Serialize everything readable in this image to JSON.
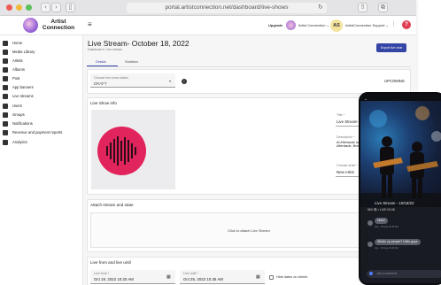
{
  "browser": {
    "url": "portal.artistconnection.net/dashboard/live-shows"
  },
  "brand": {
    "line1": "Artist",
    "line2": "Connection"
  },
  "topbar": {
    "upgrade": "Upgrade",
    "connection_menu": "Artist Connection ⌄",
    "avatar_initials": "AS",
    "support_menu": "ArtistConnection Support ⌄",
    "help": "?"
  },
  "sidebar": {
    "items": [
      {
        "label": "Home",
        "icon": "home-icon"
      },
      {
        "label": "Media Library",
        "icon": "folder-icon"
      },
      {
        "label": "Artists",
        "icon": "artist-icon"
      },
      {
        "label": "Albums",
        "icon": "album-icon"
      },
      {
        "label": "Post",
        "icon": "post-icon"
      },
      {
        "label": "App banners",
        "icon": "banner-icon"
      },
      {
        "label": "Live streams",
        "icon": "monitor-icon"
      },
      {
        "label": "Users",
        "icon": "user-icon"
      },
      {
        "label": "Groups",
        "icon": "group-icon"
      },
      {
        "label": "Notifications",
        "icon": "bell-icon"
      },
      {
        "label": "Revenue and payment reports",
        "icon": "money-icon"
      },
      {
        "label": "Analytics",
        "icon": "analytics-icon"
      }
    ]
  },
  "page": {
    "title": "Live Stream- October 18, 2022",
    "breadcrumb": "Dashboard / Live stream",
    "export_button": "Export live chat",
    "tabs": [
      {
        "label": "Details"
      },
      {
        "label": "Statistics"
      }
    ],
    "status_select": {
      "label": "Choose live show status",
      "value": "DRAFT"
    },
    "status_badge": "UPCOMING"
  },
  "info": {
    "section": "Live Show info",
    "title_label": "Title *",
    "title_value": "Live Stream- October 18, 202",
    "desc_label": "Description *",
    "desc_value": "At Afterlasde sweet cinnamon caramelization Afterlasde, Brewed frappuccino Beans extraction",
    "artist_label": "Choose artist *",
    "artist_value": "New Artist"
  },
  "attach": {
    "section": "Attach stream and state",
    "cta": "Click to attach Live Stream"
  },
  "dates": {
    "section": "Live from and live until",
    "from_label": "Live from *",
    "from_value": "Oct 18, 2022 10:20 AM",
    "until_label": "Live until *",
    "until_value": "Oct 25, 2022 10:35 AM",
    "hide_label": "Hide dates on clients"
  },
  "phone": {
    "title": "Live Stream - 10/18/22",
    "stats": "850 👁 • LIVE  00:08",
    "chat": [
      {
        "text": "Hello!",
        "meta": "Hey · 18 Aug 10:45 AM"
      },
      {
        "text": "Whats up people? Hello guys",
        "meta": "Hey · 18 Aug 10:45 AM"
      }
    ],
    "input_placeholder": "Join a comment..."
  },
  "colors": {
    "accent": "#3545a5",
    "badge": "#5b43b7",
    "waveform": "#e2245d",
    "phone_bg": "#15171d"
  }
}
